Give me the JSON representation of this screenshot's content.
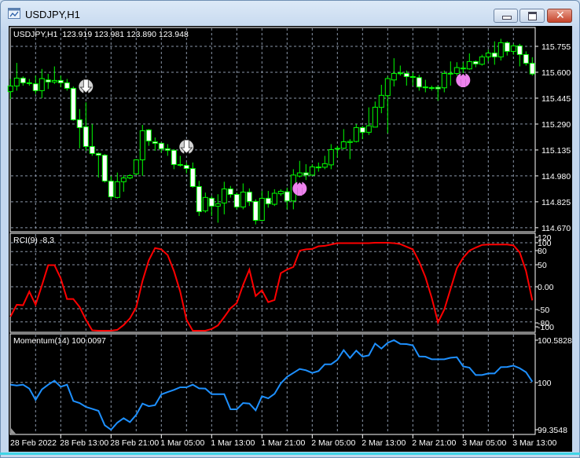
{
  "window": {
    "title": "USDJPY,H1",
    "buttons": {
      "minimize": "minimize",
      "maximize": "maximize",
      "close": "close"
    }
  },
  "colors": {
    "background": "#000000",
    "grid": "#8a96a8",
    "bull_candle": "#00ff00",
    "bear_candle_fill": "#ffffff",
    "rci_line": "#ff0000",
    "momentum_line": "#1e90ff",
    "axis_text": "#ffffff",
    "signal_up": "#ee82ee",
    "signal_down": "#d3d3d3"
  },
  "main_panel": {
    "header": "USDJPY,H1  123.919 123.981 123.890 123.948",
    "price_labels": [
      "115.755",
      "115.600",
      "115.445",
      "115.290",
      "115.135",
      "114.980",
      "114.825",
      "114.670"
    ]
  },
  "rci_panel": {
    "header": "RCI(9) -8,3",
    "labels": [
      "120",
      "100",
      "80",
      "50",
      "0.00",
      "-50",
      "-80",
      "-100"
    ]
  },
  "momentum_panel": {
    "header": "Momentum(14) 100.0097",
    "labels": [
      "100.5828",
      "100",
      "99.3548"
    ]
  },
  "time_labels": [
    "28 Feb 2022",
    "28 Feb 13:00",
    "28 Feb 21:00",
    "1 Mar 05:00",
    "1 Mar 13:00",
    "1 Mar 21:00",
    "2 Mar 05:00",
    "2 Mar 13:00",
    "2 Mar 21:00",
    "3 Mar 05:00",
    "3 Mar 13:00"
  ],
  "chart_data": [
    {
      "type": "candlestick",
      "symbol": "USDJPY",
      "timeframe": "H1",
      "ylim": [
        114.64,
        115.855
      ],
      "ohlc": [
        [
          115.484,
          115.56,
          115.44,
          115.518
        ],
        [
          115.518,
          115.656,
          115.49,
          115.565
        ],
        [
          115.565,
          115.575,
          115.52,
          115.537
        ],
        [
          115.537,
          115.56,
          115.52,
          115.534
        ],
        [
          115.531,
          115.58,
          115.47,
          115.49
        ],
        [
          115.49,
          115.62,
          115.445,
          115.562
        ],
        [
          115.554,
          115.59,
          115.5,
          115.542
        ],
        [
          115.542,
          115.635,
          115.53,
          115.551
        ],
        [
          115.551,
          115.58,
          115.51,
          115.537
        ],
        [
          115.537,
          115.56,
          115.49,
          115.504
        ],
        [
          115.504,
          115.515,
          115.31,
          115.316
        ],
        [
          115.316,
          115.38,
          115.145,
          115.269
        ],
        [
          115.274,
          115.42,
          115.13,
          115.156
        ],
        [
          115.156,
          115.29,
          115.1,
          115.114
        ],
        [
          115.114,
          115.12,
          114.97,
          115.104
        ],
        [
          115.104,
          115.11,
          114.94,
          114.949
        ],
        [
          114.949,
          114.98,
          114.84,
          114.855
        ],
        [
          114.851,
          115.0,
          114.845,
          114.945
        ],
        [
          114.945,
          114.985,
          114.885,
          114.968
        ],
        [
          114.968,
          114.99,
          114.96,
          114.982
        ],
        [
          114.992,
          115.08,
          114.985,
          115.076
        ],
        [
          115.076,
          115.285,
          114.98,
          115.25
        ],
        [
          115.255,
          115.26,
          115.16,
          115.189
        ],
        [
          115.184,
          115.21,
          115.13,
          115.175
        ],
        [
          115.175,
          115.18,
          115.12,
          115.142
        ],
        [
          115.142,
          115.17,
          115.1,
          115.133
        ],
        [
          115.133,
          115.14,
          115.02,
          115.048
        ],
        [
          115.048,
          115.1,
          115.035,
          115.045
        ],
        [
          115.043,
          115.06,
          114.995,
          115.024
        ],
        [
          115.024,
          115.06,
          114.91,
          114.916
        ],
        [
          114.916,
          114.95,
          114.74,
          114.766
        ],
        [
          114.771,
          114.88,
          114.76,
          114.851
        ],
        [
          114.846,
          114.86,
          114.74,
          114.799
        ],
        [
          114.799,
          114.87,
          114.7,
          114.813
        ],
        [
          114.818,
          114.945,
          114.75,
          114.902
        ],
        [
          114.902,
          114.92,
          114.85,
          114.869
        ],
        [
          114.869,
          114.88,
          114.78,
          114.794
        ],
        [
          114.794,
          114.935,
          114.78,
          114.883
        ],
        [
          114.883,
          114.905,
          114.8,
          114.827
        ],
        [
          114.827,
          114.84,
          114.69,
          114.714
        ],
        [
          114.714,
          114.89,
          114.71,
          114.846
        ],
        [
          114.846,
          114.89,
          114.79,
          114.813
        ],
        [
          114.81,
          114.9,
          114.8,
          114.876
        ],
        [
          114.873,
          114.9,
          114.86,
          114.888
        ],
        [
          114.885,
          114.91,
          114.78,
          114.83
        ],
        [
          114.83,
          115.02,
          114.78,
          114.985
        ],
        [
          114.979,
          115.07,
          114.97,
          114.998
        ],
        [
          114.998,
          115.05,
          114.955,
          114.985
        ],
        [
          114.985,
          115.05,
          114.98,
          115.034
        ],
        [
          115.03,
          115.06,
          115.005,
          115.033
        ],
        [
          115.032,
          115.1,
          115.02,
          115.053
        ],
        [
          115.046,
          115.17,
          115.02,
          115.137
        ],
        [
          115.14,
          115.16,
          115.09,
          115.145
        ],
        [
          115.145,
          115.26,
          115.14,
          115.184
        ],
        [
          115.18,
          115.2,
          115.08,
          115.186
        ],
        [
          115.186,
          115.29,
          115.18,
          115.269
        ],
        [
          115.269,
          115.28,
          115.2,
          115.241
        ],
        [
          115.241,
          115.39,
          115.225,
          115.28
        ],
        [
          115.272,
          115.425,
          115.27,
          115.391
        ],
        [
          115.39,
          115.525,
          115.355,
          115.462
        ],
        [
          115.46,
          115.575,
          115.235,
          115.562
        ],
        [
          115.554,
          115.684,
          115.515,
          115.593
        ],
        [
          115.593,
          115.64,
          115.58,
          115.596
        ],
        [
          115.593,
          115.61,
          115.52,
          115.574
        ],
        [
          115.574,
          115.6,
          115.52,
          115.573
        ],
        [
          115.568,
          115.585,
          115.49,
          115.512
        ],
        [
          115.512,
          115.555,
          115.48,
          115.51
        ],
        [
          115.507,
          115.52,
          115.49,
          115.508
        ],
        [
          115.51,
          115.52,
          115.43,
          115.501
        ],
        [
          115.507,
          115.61,
          115.48,
          115.593
        ],
        [
          115.593,
          115.665,
          115.52,
          115.594
        ],
        [
          115.593,
          115.66,
          115.58,
          115.628
        ],
        [
          115.625,
          115.66,
          115.575,
          115.625
        ],
        [
          115.62,
          115.713,
          115.615,
          115.664
        ],
        [
          115.664,
          115.67,
          115.63,
          115.65
        ],
        [
          115.648,
          115.705,
          115.64,
          115.692
        ],
        [
          115.692,
          115.735,
          115.665,
          115.715
        ],
        [
          115.715,
          115.785,
          115.645,
          115.692
        ],
        [
          115.692,
          115.8,
          115.67,
          115.777
        ],
        [
          115.777,
          115.785,
          115.7,
          115.725
        ],
        [
          115.725,
          115.77,
          115.705,
          115.758
        ],
        [
          115.758,
          115.77,
          115.635,
          115.706
        ],
        [
          115.706,
          115.725,
          115.64,
          115.654
        ],
        [
          115.654,
          115.69,
          115.58,
          115.59
        ]
      ],
      "signals": [
        {
          "bar": 12,
          "price": 115.515,
          "direction": "down"
        },
        {
          "bar": 28,
          "price": 115.153,
          "direction": "down"
        },
        {
          "bar": 46,
          "price": 114.904,
          "direction": "up"
        },
        {
          "bar": 72,
          "price": 115.553,
          "direction": "up"
        }
      ]
    },
    {
      "type": "line",
      "name": "RCI(9)",
      "ylim": [
        -103,
        121
      ],
      "levels": [
        100,
        80,
        50,
        0,
        -50,
        -80
      ],
      "values": [
        -68,
        -41,
        -42,
        -11,
        -41,
        3,
        49,
        49,
        19,
        -28,
        -28,
        -46,
        -75,
        -99,
        -100,
        -100,
        -100,
        -98,
        -87,
        -72,
        -47,
        13,
        60,
        88,
        85,
        72,
        36,
        -11,
        -75,
        -100,
        -100,
        -100,
        -96,
        -88,
        -69,
        -49,
        -37,
        4,
        39,
        -21,
        -8,
        -35,
        -30,
        31,
        39,
        45,
        82,
        85,
        86,
        92,
        93,
        96,
        99,
        99,
        99,
        99,
        99,
        99,
        100,
        100,
        100,
        99,
        97,
        91,
        85,
        57,
        22,
        -25,
        -81,
        -52,
        -5,
        42,
        66,
        82,
        89,
        95,
        96,
        96,
        96,
        96,
        94,
        78,
        36,
        -31
      ]
    },
    {
      "type": "line",
      "name": "Momentum(14)",
      "ylim": [
        99.3548,
        100.5828
      ],
      "levels": [
        100
      ],
      "values": [
        99.968,
        99.957,
        99.968,
        99.914,
        99.759,
        99.903,
        99.968,
        100.022,
        99.939,
        99.968,
        99.744,
        99.716,
        99.662,
        99.636,
        99.608,
        99.41,
        99.348,
        99.446,
        99.507,
        99.453,
        99.554,
        99.708,
        99.672,
        99.687,
        99.834,
        99.867,
        99.896,
        99.932,
        99.932,
        99.968,
        99.917,
        99.914,
        99.838,
        99.838,
        99.838,
        99.629,
        99.629,
        99.716,
        99.708,
        99.615,
        99.809,
        99.78,
        99.842,
        99.986,
        100.076,
        100.13,
        100.184,
        100.166,
        100.13,
        100.155,
        100.248,
        100.248,
        100.31,
        100.443,
        100.335,
        100.436,
        100.353,
        100.371,
        100.533,
        100.464,
        100.544,
        100.58,
        100.529,
        100.526,
        100.508,
        100.356,
        100.353,
        100.317,
        100.317,
        100.317,
        100.338,
        100.346,
        100.22,
        100.202,
        100.101,
        100.101,
        100.122,
        100.122,
        100.209,
        100.212,
        100.23,
        100.194,
        100.14,
        100.0097
      ]
    }
  ]
}
